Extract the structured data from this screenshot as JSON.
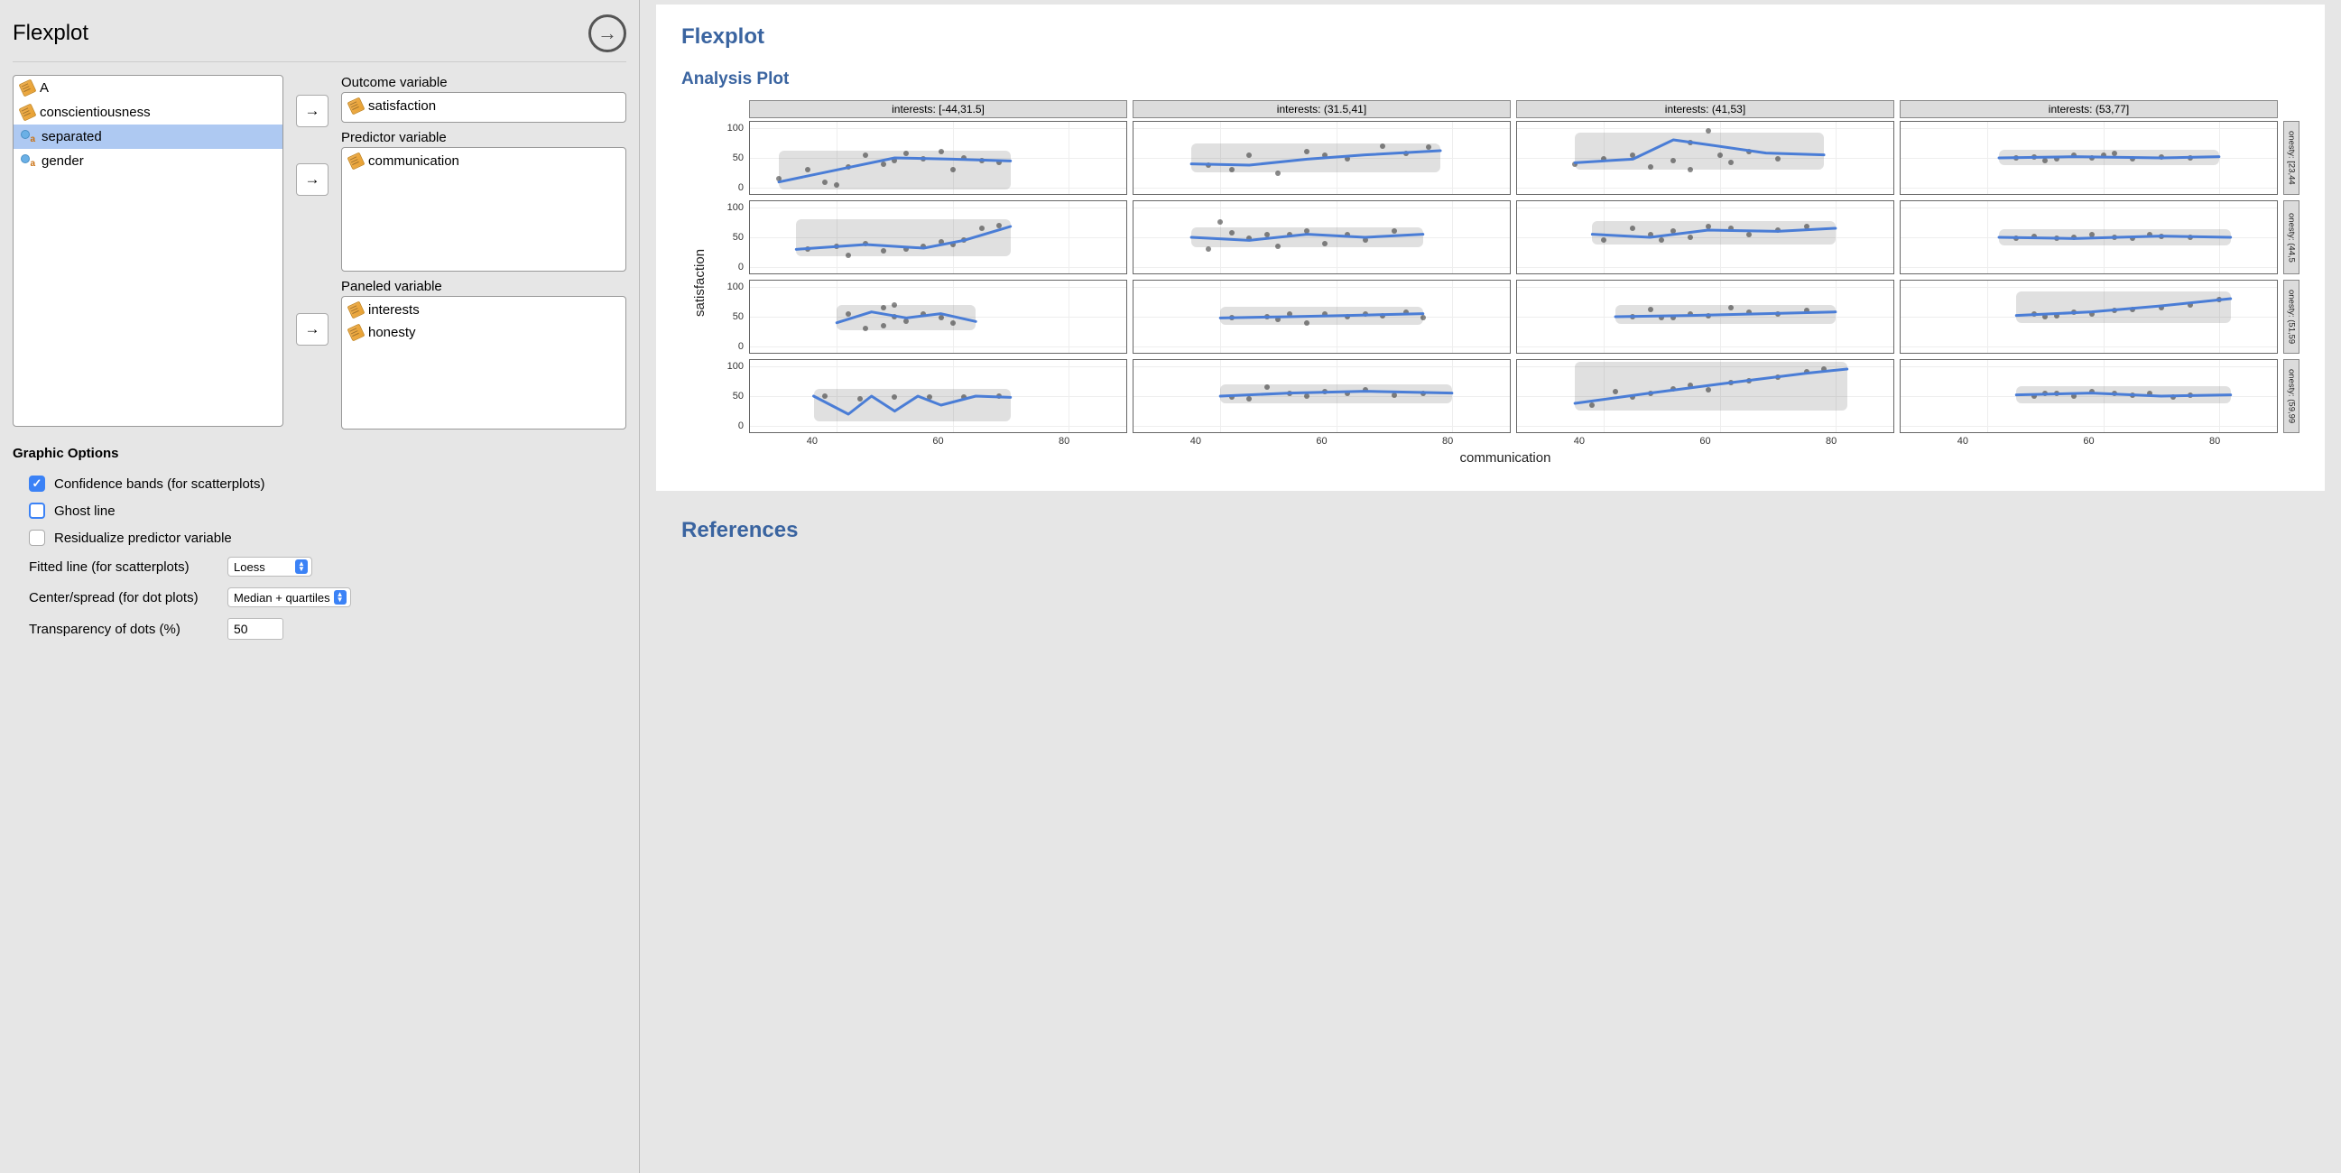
{
  "header": {
    "title": "Flexplot"
  },
  "vars": [
    {
      "name": "A",
      "type": "scale",
      "selected": false
    },
    {
      "name": "conscientiousness",
      "type": "scale",
      "selected": false
    },
    {
      "name": "separated",
      "type": "nominal",
      "selected": true
    },
    {
      "name": "gender",
      "type": "nominal",
      "selected": false
    }
  ],
  "targets": {
    "outcome": {
      "label": "Outcome variable",
      "items": [
        {
          "name": "satisfaction",
          "type": "scale"
        }
      ]
    },
    "predictor": {
      "label": "Predictor variable",
      "items": [
        {
          "name": "communication",
          "type": "scale"
        }
      ]
    },
    "paneled": {
      "label": "Paneled variable",
      "items": [
        {
          "name": "interests",
          "type": "scale"
        },
        {
          "name": "honesty",
          "type": "scale"
        }
      ]
    }
  },
  "options": {
    "title": "Graphic Options",
    "confidence": {
      "label": "Confidence bands (for scatterplots)",
      "checked": true
    },
    "ghost": {
      "label": "Ghost line",
      "checked": false,
      "focused": true
    },
    "resid": {
      "label": "Residualize predictor variable",
      "checked": false
    },
    "fitted": {
      "label": "Fitted line (for scatterplots)",
      "value": "Loess"
    },
    "center": {
      "label": "Center/spread (for dot plots)",
      "value": "Median + quartiles"
    },
    "transp": {
      "label": "Transparency of dots (%)",
      "value": "50"
    }
  },
  "output": {
    "title": "Flexplot",
    "subtitle": "Analysis Plot",
    "refs": "References"
  },
  "chart_data": {
    "type": "scatter",
    "xlabel": "communication",
    "ylabel": "satisfaction",
    "x_ticks": [
      40,
      60,
      80
    ],
    "y_ticks": [
      0,
      50,
      100
    ],
    "xlim": [
      25,
      90
    ],
    "ylim": [
      -10,
      110
    ],
    "col_facets": [
      "interests: [-44,31.5]",
      "interests: (31.5,41]",
      "interests: (41,53]",
      "interests: (53,77]"
    ],
    "row_facets": [
      "onesty: [23,44",
      "onesty: (44,5",
      "onesty: (51,59",
      "onesty: (59,99"
    ],
    "facets": [
      [
        {
          "points": [
            [
              30,
              15
            ],
            [
              35,
              30
            ],
            [
              38,
              10
            ],
            [
              42,
              35
            ],
            [
              45,
              55
            ],
            [
              48,
              40
            ],
            [
              50,
              45
            ],
            [
              55,
              48
            ],
            [
              58,
              60
            ],
            [
              62,
              50
            ],
            [
              65,
              45
            ],
            [
              60,
              30
            ],
            [
              52,
              58
            ],
            [
              68,
              42
            ],
            [
              40,
              5
            ]
          ],
          "line": [
            [
              30,
              10
            ],
            [
              40,
              30
            ],
            [
              50,
              50
            ],
            [
              60,
              48
            ],
            [
              70,
              45
            ]
          ]
        },
        {
          "points": [
            [
              38,
              38
            ],
            [
              42,
              30
            ],
            [
              45,
              55
            ],
            [
              50,
              25
            ],
            [
              55,
              60
            ],
            [
              58,
              55
            ],
            [
              62,
              48
            ],
            [
              68,
              70
            ],
            [
              72,
              58
            ],
            [
              76,
              68
            ]
          ],
          "line": [
            [
              35,
              40
            ],
            [
              45,
              38
            ],
            [
              55,
              48
            ],
            [
              65,
              55
            ],
            [
              78,
              62
            ]
          ]
        },
        {
          "points": [
            [
              35,
              40
            ],
            [
              40,
              48
            ],
            [
              45,
              55
            ],
            [
              48,
              35
            ],
            [
              52,
              45
            ],
            [
              55,
              75
            ],
            [
              58,
              95
            ],
            [
              60,
              55
            ],
            [
              65,
              60
            ],
            [
              70,
              48
            ],
            [
              62,
              42
            ],
            [
              55,
              30
            ]
          ],
          "line": [
            [
              35,
              42
            ],
            [
              45,
              48
            ],
            [
              52,
              80
            ],
            [
              58,
              72
            ],
            [
              68,
              58
            ],
            [
              78,
              55
            ]
          ]
        },
        {
          "points": [
            [
              45,
              50
            ],
            [
              48,
              52
            ],
            [
              52,
              48
            ],
            [
              55,
              55
            ],
            [
              58,
              50
            ],
            [
              62,
              58
            ],
            [
              65,
              48
            ],
            [
              70,
              52
            ],
            [
              75,
              50
            ],
            [
              50,
              45
            ],
            [
              60,
              55
            ]
          ],
          "line": [
            [
              42,
              50
            ],
            [
              55,
              52
            ],
            [
              70,
              50
            ],
            [
              80,
              52
            ]
          ]
        }
      ],
      [
        {
          "points": [
            [
              35,
              30
            ],
            [
              40,
              35
            ],
            [
              45,
              40
            ],
            [
              48,
              28
            ],
            [
              52,
              30
            ],
            [
              55,
              35
            ],
            [
              58,
              42
            ],
            [
              62,
              45
            ],
            [
              65,
              65
            ],
            [
              68,
              70
            ],
            [
              42,
              20
            ],
            [
              60,
              38
            ]
          ],
          "line": [
            [
              33,
              30
            ],
            [
              45,
              38
            ],
            [
              55,
              32
            ],
            [
              62,
              45
            ],
            [
              70,
              68
            ]
          ]
        },
        {
          "points": [
            [
              38,
              30
            ],
            [
              40,
              75
            ],
            [
              45,
              48
            ],
            [
              48,
              55
            ],
            [
              50,
              35
            ],
            [
              55,
              60
            ],
            [
              58,
              40
            ],
            [
              62,
              55
            ],
            [
              65,
              45
            ],
            [
              70,
              60
            ],
            [
              42,
              58
            ],
            [
              52,
              55
            ]
          ],
          "line": [
            [
              35,
              50
            ],
            [
              45,
              45
            ],
            [
              55,
              55
            ],
            [
              65,
              50
            ],
            [
              75,
              55
            ]
          ]
        },
        {
          "points": [
            [
              40,
              45
            ],
            [
              45,
              65
            ],
            [
              48,
              55
            ],
            [
              52,
              60
            ],
            [
              55,
              50
            ],
            [
              58,
              68
            ],
            [
              62,
              65
            ],
            [
              65,
              55
            ],
            [
              70,
              62
            ],
            [
              75,
              68
            ],
            [
              50,
              45
            ]
          ],
          "line": [
            [
              38,
              55
            ],
            [
              48,
              50
            ],
            [
              58,
              62
            ],
            [
              70,
              60
            ],
            [
              80,
              65
            ]
          ]
        },
        {
          "points": [
            [
              48,
              52
            ],
            [
              52,
              48
            ],
            [
              55,
              50
            ],
            [
              58,
              55
            ],
            [
              62,
              50
            ],
            [
              65,
              48
            ],
            [
              70,
              52
            ],
            [
              75,
              50
            ],
            [
              45,
              48
            ],
            [
              68,
              55
            ]
          ],
          "line": [
            [
              42,
              50
            ],
            [
              55,
              48
            ],
            [
              70,
              52
            ],
            [
              82,
              50
            ]
          ]
        }
      ],
      [
        {
          "points": [
            [
              42,
              55
            ],
            [
              45,
              30
            ],
            [
              48,
              65
            ],
            [
              50,
              50
            ],
            [
              52,
              42
            ],
            [
              55,
              55
            ],
            [
              58,
              48
            ],
            [
              60,
              40
            ],
            [
              50,
              70
            ],
            [
              48,
              35
            ]
          ],
          "line": [
            [
              40,
              40
            ],
            [
              46,
              58
            ],
            [
              52,
              48
            ],
            [
              58,
              55
            ],
            [
              64,
              42
            ]
          ]
        },
        {
          "points": [
            [
              42,
              48
            ],
            [
              48,
              50
            ],
            [
              52,
              55
            ],
            [
              55,
              40
            ],
            [
              58,
              55
            ],
            [
              62,
              50
            ],
            [
              65,
              55
            ],
            [
              68,
              52
            ],
            [
              72,
              58
            ],
            [
              75,
              48
            ],
            [
              50,
              45
            ]
          ],
          "line": [
            [
              40,
              48
            ],
            [
              52,
              50
            ],
            [
              62,
              52
            ],
            [
              75,
              55
            ]
          ]
        },
        {
          "points": [
            [
              45,
              50
            ],
            [
              48,
              62
            ],
            [
              52,
              48
            ],
            [
              55,
              55
            ],
            [
              58,
              52
            ],
            [
              62,
              65
            ],
            [
              65,
              58
            ],
            [
              70,
              55
            ],
            [
              75,
              60
            ],
            [
              50,
              48
            ]
          ],
          "line": [
            [
              42,
              50
            ],
            [
              55,
              52
            ],
            [
              68,
              55
            ],
            [
              80,
              58
            ]
          ]
        },
        {
          "points": [
            [
              48,
              55
            ],
            [
              52,
              52
            ],
            [
              55,
              58
            ],
            [
              58,
              55
            ],
            [
              62,
              60
            ],
            [
              65,
              62
            ],
            [
              70,
              65
            ],
            [
              75,
              70
            ],
            [
              80,
              78
            ],
            [
              50,
              50
            ]
          ],
          "line": [
            [
              45,
              52
            ],
            [
              58,
              58
            ],
            [
              70,
              68
            ],
            [
              82,
              80
            ]
          ]
        }
      ],
      [
        {
          "points": [
            [
              38,
              50
            ],
            [
              44,
              45
            ],
            [
              50,
              48
            ],
            [
              56,
              48
            ],
            [
              62,
              48
            ],
            [
              68,
              50
            ]
          ],
          "line": [
            [
              36,
              50
            ],
            [
              42,
              20
            ],
            [
              46,
              50
            ],
            [
              50,
              25
            ],
            [
              54,
              50
            ],
            [
              58,
              35
            ],
            [
              64,
              50
            ],
            [
              70,
              48
            ]
          ]
        },
        {
          "points": [
            [
              42,
              48
            ],
            [
              48,
              65
            ],
            [
              52,
              55
            ],
            [
              55,
              50
            ],
            [
              58,
              58
            ],
            [
              62,
              55
            ],
            [
              65,
              60
            ],
            [
              70,
              52
            ],
            [
              75,
              55
            ],
            [
              45,
              45
            ]
          ],
          "line": [
            [
              40,
              50
            ],
            [
              52,
              55
            ],
            [
              65,
              58
            ],
            [
              80,
              55
            ]
          ]
        },
        {
          "points": [
            [
              38,
              35
            ],
            [
              42,
              58
            ],
            [
              48,
              55
            ],
            [
              52,
              62
            ],
            [
              55,
              68
            ],
            [
              58,
              60
            ],
            [
              62,
              72
            ],
            [
              65,
              75
            ],
            [
              70,
              82
            ],
            [
              75,
              90
            ],
            [
              78,
              95
            ],
            [
              45,
              48
            ]
          ],
          "line": [
            [
              35,
              38
            ],
            [
              48,
              55
            ],
            [
              60,
              70
            ],
            [
              75,
              88
            ],
            [
              82,
              95
            ]
          ]
        },
        {
          "points": [
            [
              48,
              50
            ],
            [
              52,
              55
            ],
            [
              55,
              50
            ],
            [
              58,
              58
            ],
            [
              62,
              55
            ],
            [
              65,
              52
            ],
            [
              68,
              55
            ],
            [
              72,
              48
            ],
            [
              75,
              52
            ],
            [
              50,
              55
            ]
          ],
          "line": [
            [
              45,
              52
            ],
            [
              58,
              55
            ],
            [
              70,
              50
            ],
            [
              82,
              52
            ]
          ]
        }
      ]
    ]
  }
}
